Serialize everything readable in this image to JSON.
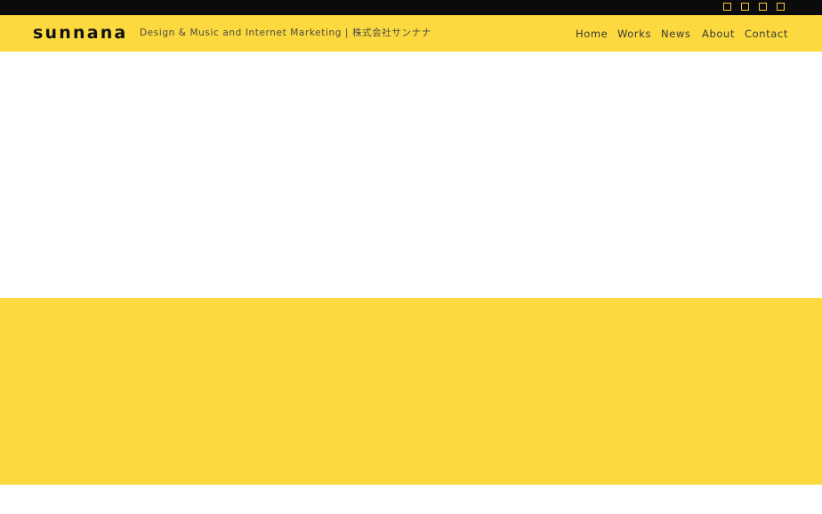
{
  "brand": {
    "logo": "sunnana",
    "tagline": "Design & Music and Internet Marketing | 株式会社サンナナ"
  },
  "social_icons": [
    {
      "name": "social-link-1",
      "icon": "square-outline-icon"
    },
    {
      "name": "social-link-2",
      "icon": "square-outline-icon"
    },
    {
      "name": "social-link-3",
      "icon": "square-outline-icon"
    },
    {
      "name": "social-link-4",
      "icon": "square-outline-icon"
    }
  ],
  "nav": {
    "home": "Home",
    "works": "Works",
    "news": "News",
    "about": "About",
    "contact": "Contact"
  },
  "colors": {
    "accent_yellow": "#fcd93f",
    "topbar_black": "#0b0b0b",
    "icon_gold": "#f4c53a"
  }
}
